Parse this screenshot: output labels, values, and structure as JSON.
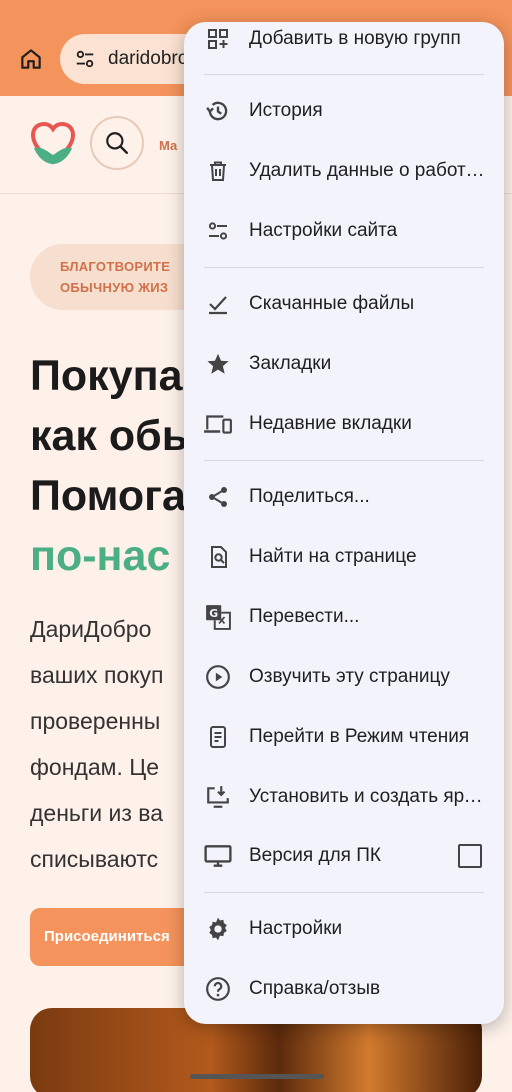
{
  "browser": {
    "url_text": "daridobro"
  },
  "site": {
    "nav_text": "Ма",
    "badge_line1": "БЛАГОТВОРИТЕ",
    "badge_line2": "ОБЫЧНУЮ ЖИЗ",
    "hero_line1": "Покупа",
    "hero_line2": "как обы",
    "hero_line3": "Помога",
    "hero_line4": "по-нас",
    "lead_line1": "ДариДобро",
    "lead_line2": "ваших покуп",
    "lead_line3": "проверенны",
    "lead_line4": "фондам. Це",
    "lead_line5": "деньги из ва",
    "lead_line6": "списываютс",
    "cta_label": "Присоединиться"
  },
  "menu": {
    "items": [
      {
        "label": "Добавить в новую групп",
        "icon": "add-to-group-icon"
      },
      {
        "label": "История",
        "icon": "history-icon"
      },
      {
        "label": "Удалить данные о работе в браузере",
        "icon": "trash-icon"
      },
      {
        "label": "Настройки сайта",
        "icon": "site-settings-icon"
      },
      {
        "label": "Скачанные файлы",
        "icon": "downloads-icon"
      },
      {
        "label": "Закладки",
        "icon": "star-icon"
      },
      {
        "label": "Недавние вкладки",
        "icon": "devices-icon"
      },
      {
        "label": "Поделиться...",
        "icon": "share-icon"
      },
      {
        "label": "Найти на странице",
        "icon": "find-in-page-icon"
      },
      {
        "label": "Перевести...",
        "icon": "translate-icon"
      },
      {
        "label": "Озвучить эту страницу",
        "icon": "play-icon"
      },
      {
        "label": "Перейти в Режим чтения",
        "icon": "reader-mode-icon"
      },
      {
        "label": "Установить и создать ярлык",
        "icon": "install-icon"
      },
      {
        "label": "Версия для ПК",
        "icon": "desktop-icon"
      },
      {
        "label": "Настройки",
        "icon": "settings-gear-icon"
      },
      {
        "label": "Справка/отзыв",
        "icon": "help-icon"
      }
    ],
    "desktop_version_checked": false
  },
  "colors": {
    "toolbar": "#f4935b",
    "accent_green": "#4cae84",
    "menu_bg": "#f3f4fb"
  }
}
